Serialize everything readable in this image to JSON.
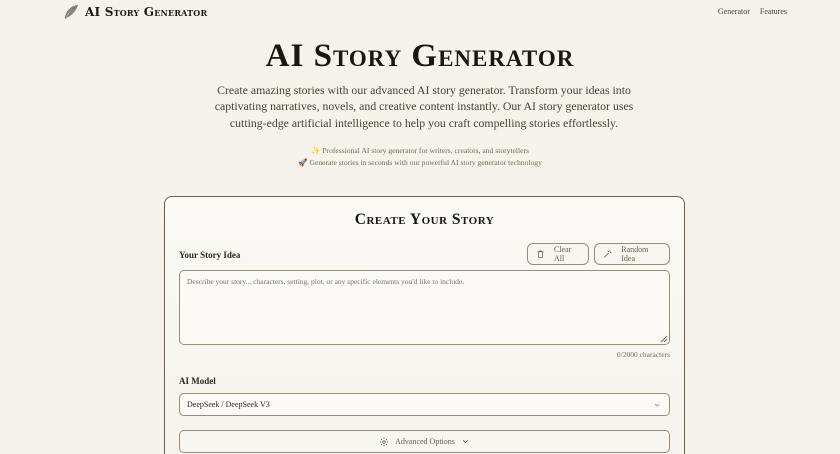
{
  "header": {
    "logo_text": "AI Story Generator",
    "nav": [
      "Generator",
      "Features"
    ]
  },
  "hero": {
    "title": "AI Story Generator",
    "description": "Create amazing stories with our advanced AI story generator. Transform your ideas into captivating narratives, novels, and creative content instantly. Our AI story generator uses cutting-edge artificial intelligence to help you craft compelling stories effortlessly.",
    "tag1": "✨ Professional AI story generator for writers, creators, and storytellers",
    "tag2": "🚀 Generate stories in seconds with our powerful AI story generator technology"
  },
  "form": {
    "title": "Create Your Story",
    "story_label": "Your Story Idea",
    "clear_label": "Clear All",
    "random_label": "Random Idea",
    "story_placeholder": "Describe your story... characters, setting, plot, or any specific elements you'd like to include.",
    "char_counter": "0/2000 characters",
    "model_label": "AI Model",
    "model_value": "DeepSeek / DeepSeek V3",
    "advanced_label": "Advanced Options"
  },
  "colors": {
    "background": "#f6f3ec",
    "border": "#9a8d75",
    "text": "#2b2419"
  },
  "icons": [
    "quill-icon",
    "trash-icon",
    "magic-wand-icon",
    "settings-icon",
    "chevron-down-icon"
  ]
}
